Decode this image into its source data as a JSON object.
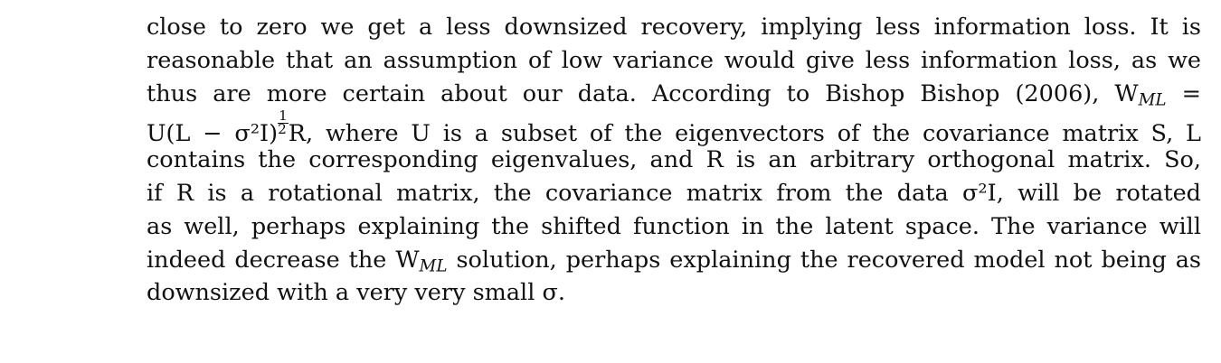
{
  "paragraph": {
    "lines": [
      "close to zero we get a less downsized recovery, implying less information loss. It is",
      "reasonable that an assumption of low variance would give less information loss, as we",
      "thus are more certain about our data. According to Bishop Bishop (2006), W",
      "U(L − σ²I)",
      "contains the corresponding eigenvalues, and R is an arbitrary orthogonal matrix. So,",
      "if R is a rotational matrix, the covariance matrix from the data σ²I, will be rotated",
      "as well, perhaps explaining the shifted function in the latent space. The variance will",
      "indeed decrease the W",
      "downsized with a very very small σ."
    ],
    "line3_tail": "=",
    "line4_tail": "R, where U is a subset of the eigenvectors of the covariance matrix S, L",
    "line8_tail": "solution, perhaps explaining the recovered model not being as",
    "subscript_ml": "ML",
    "frac_num": "1",
    "frac_den": "2"
  }
}
